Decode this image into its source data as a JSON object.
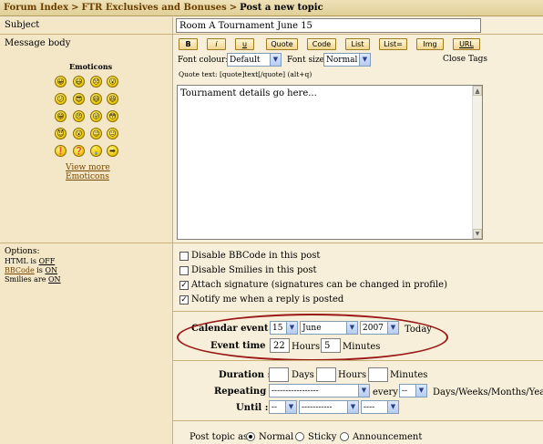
{
  "breadcrumb": {
    "items": [
      "Forum Index",
      "FTR Exclusives and Bonuses",
      "Post a new topic"
    ],
    "sep": ">"
  },
  "subject": {
    "label": "Subject",
    "value": "Room A Tournament June 15"
  },
  "message": {
    "label": "Message body",
    "emoticons_title": "Emoticons",
    "emoticons": [
      "😀",
      "😃",
      "😞",
      "😮",
      "😕",
      "😎",
      "😄",
      "😆",
      "😁",
      "😠",
      "😛",
      "😳",
      "😈",
      "😮",
      "😉",
      "😐",
      "❗",
      "❓",
      "💡",
      "➡"
    ],
    "view_more": "View more",
    "view_more2": "Emoticons",
    "body_text": "Tournament details go here..."
  },
  "toolbar": {
    "buttons": [
      "B",
      "i",
      "u",
      "Quote",
      "Code",
      "List",
      "List=",
      "Img",
      "URL"
    ],
    "font_colour_label": "Font colour:",
    "font_colour_value": "Default",
    "font_size_label": "Font size:",
    "font_size_value": "Normal",
    "close_tags": "Close Tags",
    "quote_hint": "Quote text: [quote]text[/quote]  (alt+q)"
  },
  "options": {
    "label": "Options:",
    "html": "HTML is ",
    "html_val": "OFF",
    "bbcode": "BBCode",
    "bbcode_is": " is ",
    "bbcode_val": "ON",
    "smilies": "Smilies are ",
    "smilies_val": "ON",
    "checks": [
      {
        "label": "Disable BBCode in this post",
        "checked": false
      },
      {
        "label": "Disable Smilies in this post",
        "checked": false
      },
      {
        "label": "Attach signature (signatures can be changed in profile)",
        "checked": true
      },
      {
        "label": "Notify me when a reply is posted",
        "checked": true
      }
    ]
  },
  "calendar": {
    "event_label": "Calendar event :",
    "day": "15",
    "month": "June",
    "year": "2007",
    "today": "Today",
    "time_label": "Event time :",
    "hours_val": "22",
    "hours_label": "Hours",
    "minutes_val": "5",
    "minutes_label": "Minutes",
    "duration_label": "Duration :",
    "days_label": "Days",
    "dur_hours_label": "Hours",
    "dur_minutes_label": "Minutes",
    "repeating_label": "Repeating :",
    "repeating_value": "-----------------",
    "every_label": "every",
    "every_value": "--",
    "unit_label": "Days/Weeks/Months/Years",
    "until_label": "Until :",
    "until_day": "--",
    "until_month": "-----------",
    "until_year": "----"
  },
  "post_as": {
    "label": "Post topic as:",
    "options": [
      "Normal",
      "Sticky",
      "Announcement"
    ],
    "selected": "Normal"
  },
  "colors": {
    "accent": "#9a1818",
    "link": "#7a4a00",
    "panel": "#f7efd9"
  }
}
